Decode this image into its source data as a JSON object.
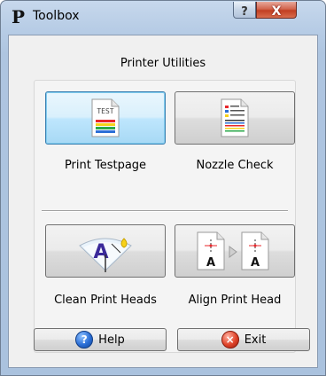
{
  "window": {
    "title": "Toolbox",
    "logo": "P"
  },
  "title_buttons": {
    "help": "?",
    "close": "X"
  },
  "section": {
    "title": "Printer Utilities"
  },
  "tools": [
    {
      "label": "Print Testpage",
      "icon": "test-page-icon",
      "page_text": "TEST"
    },
    {
      "label": "Nozzle Check",
      "icon": "nozzle-check-icon"
    },
    {
      "label": "Clean Print Heads",
      "icon": "clean-print-heads-icon",
      "glyph": "A"
    },
    {
      "label": "Align Print Head",
      "icon": "align-print-head-icon",
      "glyph": "A"
    }
  ],
  "buttons": {
    "help": {
      "label": "Help",
      "icon": "help-icon",
      "glyph": "?"
    },
    "exit": {
      "label": "Exit",
      "icon": "exit-icon",
      "glyph": "×"
    }
  },
  "colors": {
    "frame": "#b8cde6",
    "active_button": "#bee6fd",
    "close_button": "#c23f22"
  }
}
